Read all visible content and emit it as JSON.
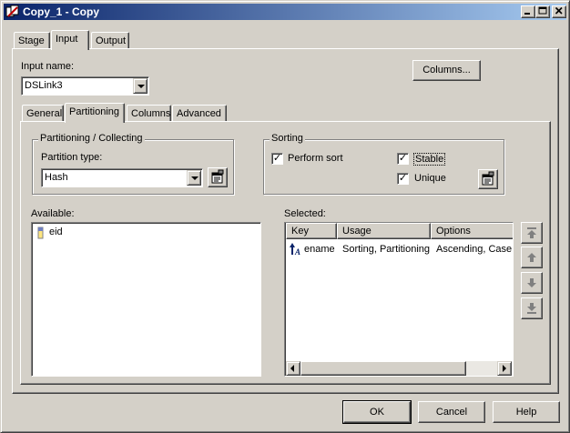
{
  "window": {
    "title": "Copy_1 - Copy",
    "controls": [
      "minimize",
      "maximize",
      "close"
    ]
  },
  "outer_tabs": [
    {
      "label": "Stage",
      "active": false
    },
    {
      "label": "Input",
      "active": true
    },
    {
      "label": "Output",
      "active": false
    }
  ],
  "input_name": {
    "label": "Input name:",
    "value": "DSLink3"
  },
  "columns_button": "Columns...",
  "inner_tabs": [
    {
      "label": "General",
      "active": false
    },
    {
      "label": "Partitioning",
      "active": true
    },
    {
      "label": "Columns",
      "active": false
    },
    {
      "label": "Advanced",
      "active": false
    }
  ],
  "partitioning": {
    "group_title": "Partitioning / Collecting",
    "type_label": "Partition type:",
    "type_value": "Hash"
  },
  "sorting": {
    "group_title": "Sorting",
    "perform_sort": {
      "label": "Perform sort",
      "checked": true
    },
    "stable": {
      "label": "Stable",
      "checked": true
    },
    "unique": {
      "label": "Unique",
      "checked": true
    }
  },
  "available": {
    "label": "Available:",
    "items": [
      "eid"
    ]
  },
  "selected": {
    "label": "Selected:",
    "columns": [
      "Key",
      "Usage",
      "Options"
    ],
    "rows": [
      {
        "key": "ename",
        "usage": "Sorting, Partitioning",
        "options": "Ascending, Case"
      }
    ]
  },
  "footer": {
    "ok": "OK",
    "cancel": "Cancel",
    "help": "Help"
  }
}
